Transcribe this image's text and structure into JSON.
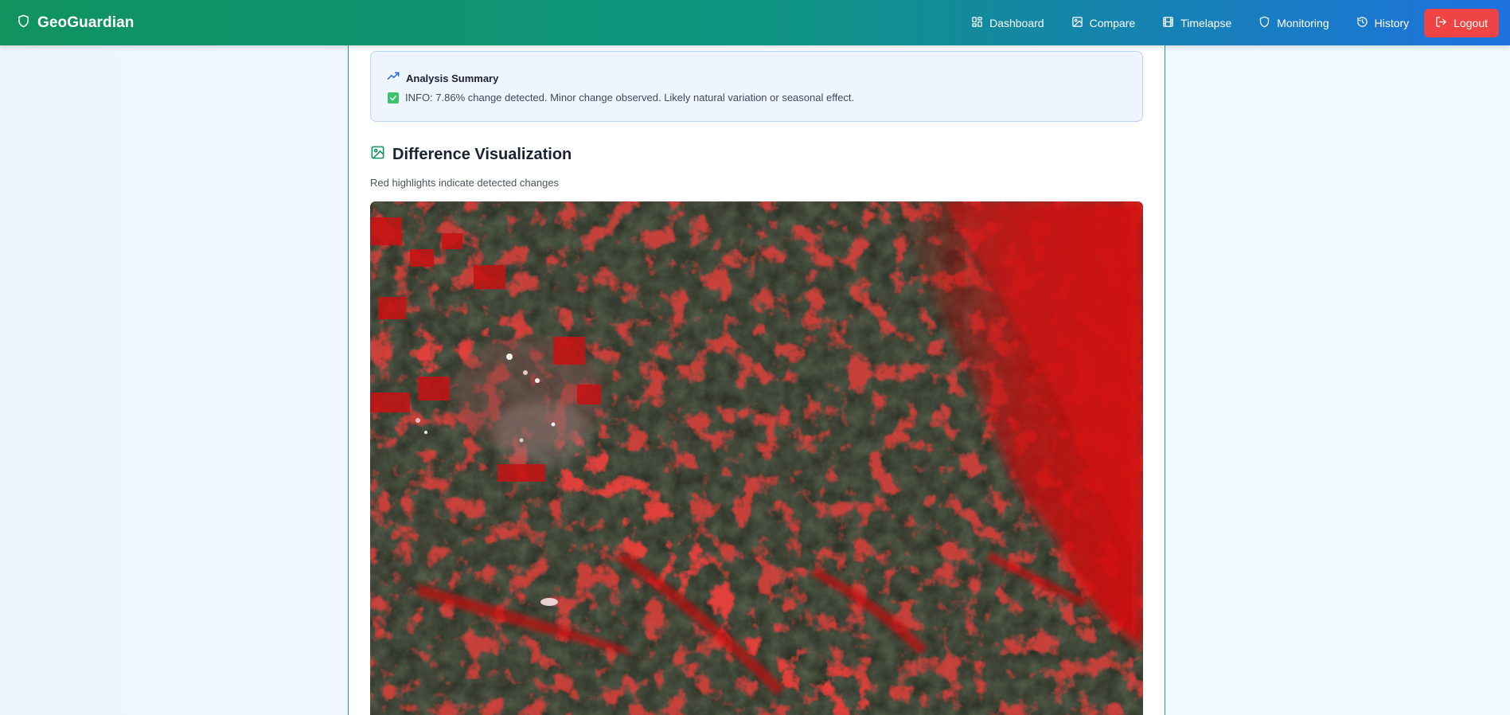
{
  "app": {
    "name": "GeoGuardian"
  },
  "nav": {
    "items": [
      {
        "label": "Dashboard",
        "icon": "dashboard-icon"
      },
      {
        "label": "Compare",
        "icon": "image-icon"
      },
      {
        "label": "Timelapse",
        "icon": "film-icon"
      },
      {
        "label": "Monitoring",
        "icon": "shield-icon"
      },
      {
        "label": "History",
        "icon": "history-icon"
      }
    ],
    "logout_label": "Logout"
  },
  "summary": {
    "title": "Analysis Summary",
    "message": "INFO: 7.86% change detected. Minor change observed. Likely natural variation or seasonal effect."
  },
  "visualization": {
    "title": "Difference Visualization",
    "subtitle": "Red highlights indicate detected changes"
  },
  "colors": {
    "nav_start": "#10935f",
    "nav_end": "#1d72e0",
    "logout": "#ee4444",
    "change_highlight": "#e01010",
    "info_check": "#3cc36b"
  }
}
